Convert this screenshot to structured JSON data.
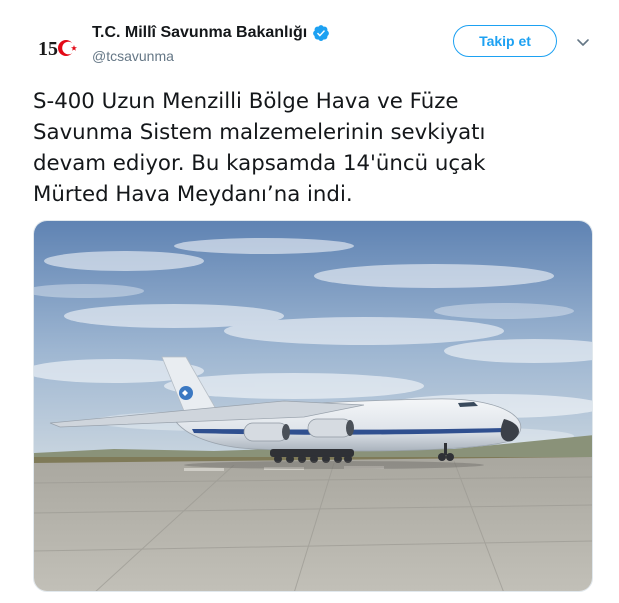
{
  "account": {
    "display_name": "T.C. Millî Savunma Bakanlığı",
    "handle": "@tcsavunma",
    "verified": true,
    "avatar_text": "15",
    "avatar_icon": "15-temmuz-logo"
  },
  "actions": {
    "follow_label": "Takip et",
    "more_icon": "chevron-down-icon"
  },
  "tweet": {
    "text": "S-400 Uzun Menzilli Bölge Hava ve Füze\nSavunma Sistem malzemelerinin sevkiyatı\ndevam ediyor. Bu kapsamda 14'üncü uçak\nMürted Hava Meydanı’na indi."
  },
  "media": {
    "subject": "aircraft-on-runway",
    "sky_color": "#7f9ec3",
    "tarmac_color": "#b8b6af"
  },
  "colors": {
    "accent": "#1da1f2",
    "text": "#14171a",
    "secondary": "#657786"
  }
}
